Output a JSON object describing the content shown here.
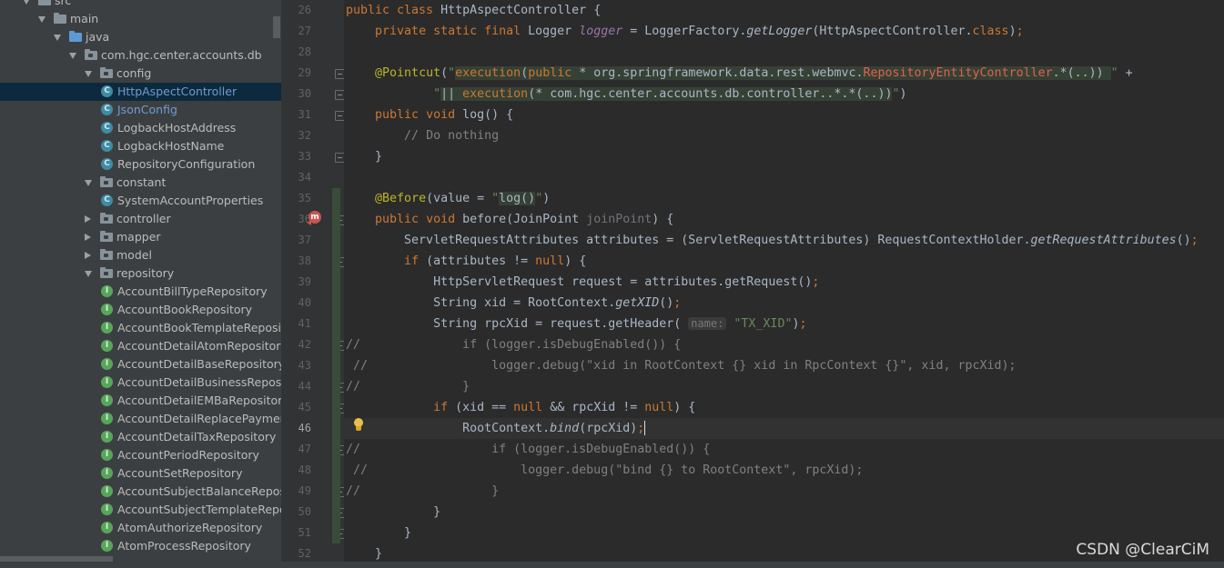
{
  "project_tree": {
    "rows": [
      {
        "label": "src",
        "kind": "folder",
        "arrow": "down",
        "indent": 0
      },
      {
        "label": "main",
        "kind": "folder",
        "arrow": "down",
        "indent": 1
      },
      {
        "label": "java",
        "kind": "srcfolder",
        "arrow": "down",
        "indent": 2
      },
      {
        "label": "com.hgc.center.accounts.db",
        "kind": "package",
        "arrow": "down",
        "indent": 3
      },
      {
        "label": "config",
        "kind": "package",
        "arrow": "down",
        "indent": 4
      },
      {
        "label": "HttpAspectController",
        "kind": "class",
        "indent": 5,
        "selected": true
      },
      {
        "label": "JsonConfig",
        "kind": "class",
        "indent": 5,
        "blue": true
      },
      {
        "label": "LogbackHostAddress",
        "kind": "class",
        "indent": 5
      },
      {
        "label": "LogbackHostName",
        "kind": "class",
        "indent": 5
      },
      {
        "label": "RepositoryConfiguration",
        "kind": "class",
        "indent": 5
      },
      {
        "label": "constant",
        "kind": "package",
        "arrow": "down",
        "indent": 4
      },
      {
        "label": "SystemAccountProperties",
        "kind": "class",
        "indent": 5
      },
      {
        "label": "controller",
        "kind": "package",
        "arrow": "right",
        "indent": 4
      },
      {
        "label": "mapper",
        "kind": "package",
        "arrow": "right",
        "indent": 4
      },
      {
        "label": "model",
        "kind": "package",
        "arrow": "right",
        "indent": 4
      },
      {
        "label": "repository",
        "kind": "package",
        "arrow": "down",
        "indent": 4
      },
      {
        "label": "AccountBillTypeRepository",
        "kind": "interface",
        "indent": 5
      },
      {
        "label": "AccountBookRepository",
        "kind": "interface",
        "indent": 5
      },
      {
        "label": "AccountBookTemplateReposit",
        "kind": "interface",
        "indent": 5
      },
      {
        "label": "AccountDetailAtomRepository",
        "kind": "interface",
        "indent": 5
      },
      {
        "label": "AccountDetailBaseRepository",
        "kind": "interface",
        "indent": 5
      },
      {
        "label": "AccountDetailBusinessReposito",
        "kind": "interface",
        "indent": 5
      },
      {
        "label": "AccountDetailEMBaRepository",
        "kind": "interface",
        "indent": 5
      },
      {
        "label": "AccountDetailReplacePaymentI",
        "kind": "interface",
        "indent": 5
      },
      {
        "label": "AccountDetailTaxRepository",
        "kind": "interface",
        "indent": 5
      },
      {
        "label": "AccountPeriodRepository",
        "kind": "interface",
        "indent": 5
      },
      {
        "label": "AccountSetRepository",
        "kind": "interface",
        "indent": 5
      },
      {
        "label": "AccountSubjectBalanceReposit",
        "kind": "interface",
        "indent": 5
      },
      {
        "label": "AccountSubjectTemplateRepos",
        "kind": "interface",
        "indent": 5
      },
      {
        "label": "AtomAuthorizeRepository",
        "kind": "interface",
        "indent": 5
      },
      {
        "label": "AtomProcessRepository",
        "kind": "interface",
        "indent": 5
      }
    ]
  },
  "editor": {
    "current_line": 46,
    "lines": [
      {
        "n": 26,
        "parts": [
          [
            "kw",
            "public class "
          ],
          [
            "",
            "HttpAspectController {"
          ]
        ]
      },
      {
        "n": 27,
        "parts": [
          [
            "",
            "    "
          ],
          [
            "kw",
            "private static final "
          ],
          [
            "",
            "Logger "
          ],
          [
            "fld",
            "logger"
          ],
          [
            "",
            " = LoggerFactory."
          ],
          [
            "itl",
            "getLogger"
          ],
          [
            "",
            "(HttpAspectController."
          ],
          [
            "kw",
            "class"
          ],
          [
            "",
            ")"
          ],
          [
            "kw",
            ";"
          ]
        ]
      },
      {
        "n": 28,
        "parts": []
      },
      {
        "n": 29,
        "parts": [
          [
            "",
            "    "
          ],
          [
            "ann",
            "@Pointcut"
          ],
          [
            "",
            "("
          ],
          [
            "str",
            "\""
          ],
          [
            "inj-pc",
            "execution"
          ],
          [
            "inj",
            "("
          ],
          [
            "inj-pc",
            "public"
          ],
          [
            "inj",
            " * org.springframework.data.rest.webmvc."
          ],
          [
            "inj-red",
            "RepositoryEntityController"
          ],
          [
            "inj",
            ".*(..)) "
          ],
          [
            "str",
            "\""
          ],
          [
            "",
            " +"
          ]
        ]
      },
      {
        "n": 30,
        "parts": [
          [
            "",
            "            "
          ],
          [
            "str",
            "\""
          ],
          [
            "inj",
            "|| "
          ],
          [
            "inj-pc",
            "execution"
          ],
          [
            "inj",
            "(* com.hgc.center.accounts.db.controller..*.*(..))"
          ],
          [
            "str",
            "\""
          ],
          [
            "",
            ")"
          ]
        ]
      },
      {
        "n": 31,
        "parts": [
          [
            "",
            "    "
          ],
          [
            "kw",
            "public void "
          ],
          [
            "",
            "log() {"
          ]
        ]
      },
      {
        "n": 32,
        "parts": [
          [
            "",
            "        "
          ],
          [
            "cmt",
            "// Do nothing"
          ]
        ]
      },
      {
        "n": 33,
        "parts": [
          [
            "",
            "    }"
          ]
        ]
      },
      {
        "n": 34,
        "parts": []
      },
      {
        "n": 35,
        "parts": [
          [
            "",
            "    "
          ],
          [
            "ann",
            "@Before"
          ],
          [
            "",
            "(value = "
          ],
          [
            "str",
            "\""
          ],
          [
            "inj",
            "log()"
          ],
          [
            "str",
            "\""
          ],
          [
            "",
            ")"
          ]
        ]
      },
      {
        "n": 36,
        "parts": [
          [
            "",
            "    "
          ],
          [
            "kw",
            "public void "
          ],
          [
            "",
            "before(JoinPoint "
          ],
          [
            "par",
            "joinPoint"
          ],
          [
            "",
            ") {"
          ]
        ]
      },
      {
        "n": 37,
        "parts": [
          [
            "",
            "        ServletRequestAttributes attributes = (ServletRequestAttributes) RequestContextHolder."
          ],
          [
            "itl",
            "getRequestAttributes"
          ],
          [
            "",
            "()"
          ],
          [
            "kw",
            ";"
          ]
        ]
      },
      {
        "n": 38,
        "parts": [
          [
            "",
            "        "
          ],
          [
            "kw",
            "if "
          ],
          [
            "",
            "(attributes != "
          ],
          [
            "kw",
            "null"
          ],
          [
            "",
            ") {"
          ]
        ]
      },
      {
        "n": 39,
        "parts": [
          [
            "",
            "            HttpServletRequest request = attributes.getRequest()"
          ],
          [
            "kw",
            ";"
          ]
        ]
      },
      {
        "n": 40,
        "parts": [
          [
            "",
            "            String xid = RootContext."
          ],
          [
            "itl",
            "getXID"
          ],
          [
            "",
            "()"
          ],
          [
            "kw",
            ";"
          ]
        ]
      },
      {
        "n": 41,
        "parts": [
          [
            "",
            "            String rpcXid = request.getHeader( "
          ],
          [
            "hint",
            "name:"
          ],
          [
            "",
            " "
          ],
          [
            "str",
            "\"TX_XID\""
          ],
          [
            "",
            ")"
          ],
          [
            "kw",
            ";"
          ]
        ]
      },
      {
        "n": 42,
        "parts": [
          [
            "cmt",
            "//              if (logger.isDebugEnabled()) {"
          ]
        ]
      },
      {
        "n": 43,
        "parts": [
          [
            "cmt",
            " //                 logger.debug(\"xid in RootContext {} xid in RpcContext {}\", xid, rpcXid);"
          ]
        ]
      },
      {
        "n": 44,
        "parts": [
          [
            "cmt",
            "//              }"
          ]
        ]
      },
      {
        "n": 45,
        "parts": [
          [
            "",
            "            "
          ],
          [
            "kw",
            "if "
          ],
          [
            "",
            "(xid == "
          ],
          [
            "kw",
            "null "
          ],
          [
            "",
            "&& rpcXid != "
          ],
          [
            "kw",
            "null"
          ],
          [
            "",
            ") {"
          ]
        ]
      },
      {
        "n": 46,
        "parts": [
          [
            "",
            "                RootContext."
          ],
          [
            "itl",
            "bind"
          ],
          [
            "",
            "(rpcXid)"
          ],
          [
            "kw",
            ";"
          ],
          [
            "caret",
            ""
          ]
        ]
      },
      {
        "n": 47,
        "parts": [
          [
            "cmt",
            "//                  if (logger.isDebugEnabled()) {"
          ]
        ]
      },
      {
        "n": 48,
        "parts": [
          [
            "cmt",
            " //                     logger.debug(\"bind {} to RootContext\", rpcXid);"
          ]
        ]
      },
      {
        "n": 49,
        "parts": [
          [
            "cmt",
            "//                  }"
          ]
        ]
      },
      {
        "n": 50,
        "parts": [
          [
            "",
            "            }"
          ]
        ]
      },
      {
        "n": 51,
        "parts": [
          [
            "",
            "        }"
          ]
        ]
      },
      {
        "n": 52,
        "parts": [
          [
            "",
            "    }"
          ]
        ]
      }
    ],
    "fold_lines": [
      29,
      30,
      31,
      33,
      36,
      38,
      42,
      44,
      45,
      47,
      49,
      50,
      51
    ]
  },
  "watermark": "CSDN @ClearCiM",
  "colors": {
    "tree_bg": "#3c3f41",
    "editor_bg": "#2b2b2b",
    "gutter_bg": "#313335",
    "keyword": "#cc7832",
    "string": "#6a8759",
    "annotation": "#bbb529",
    "comment": "#808080"
  }
}
